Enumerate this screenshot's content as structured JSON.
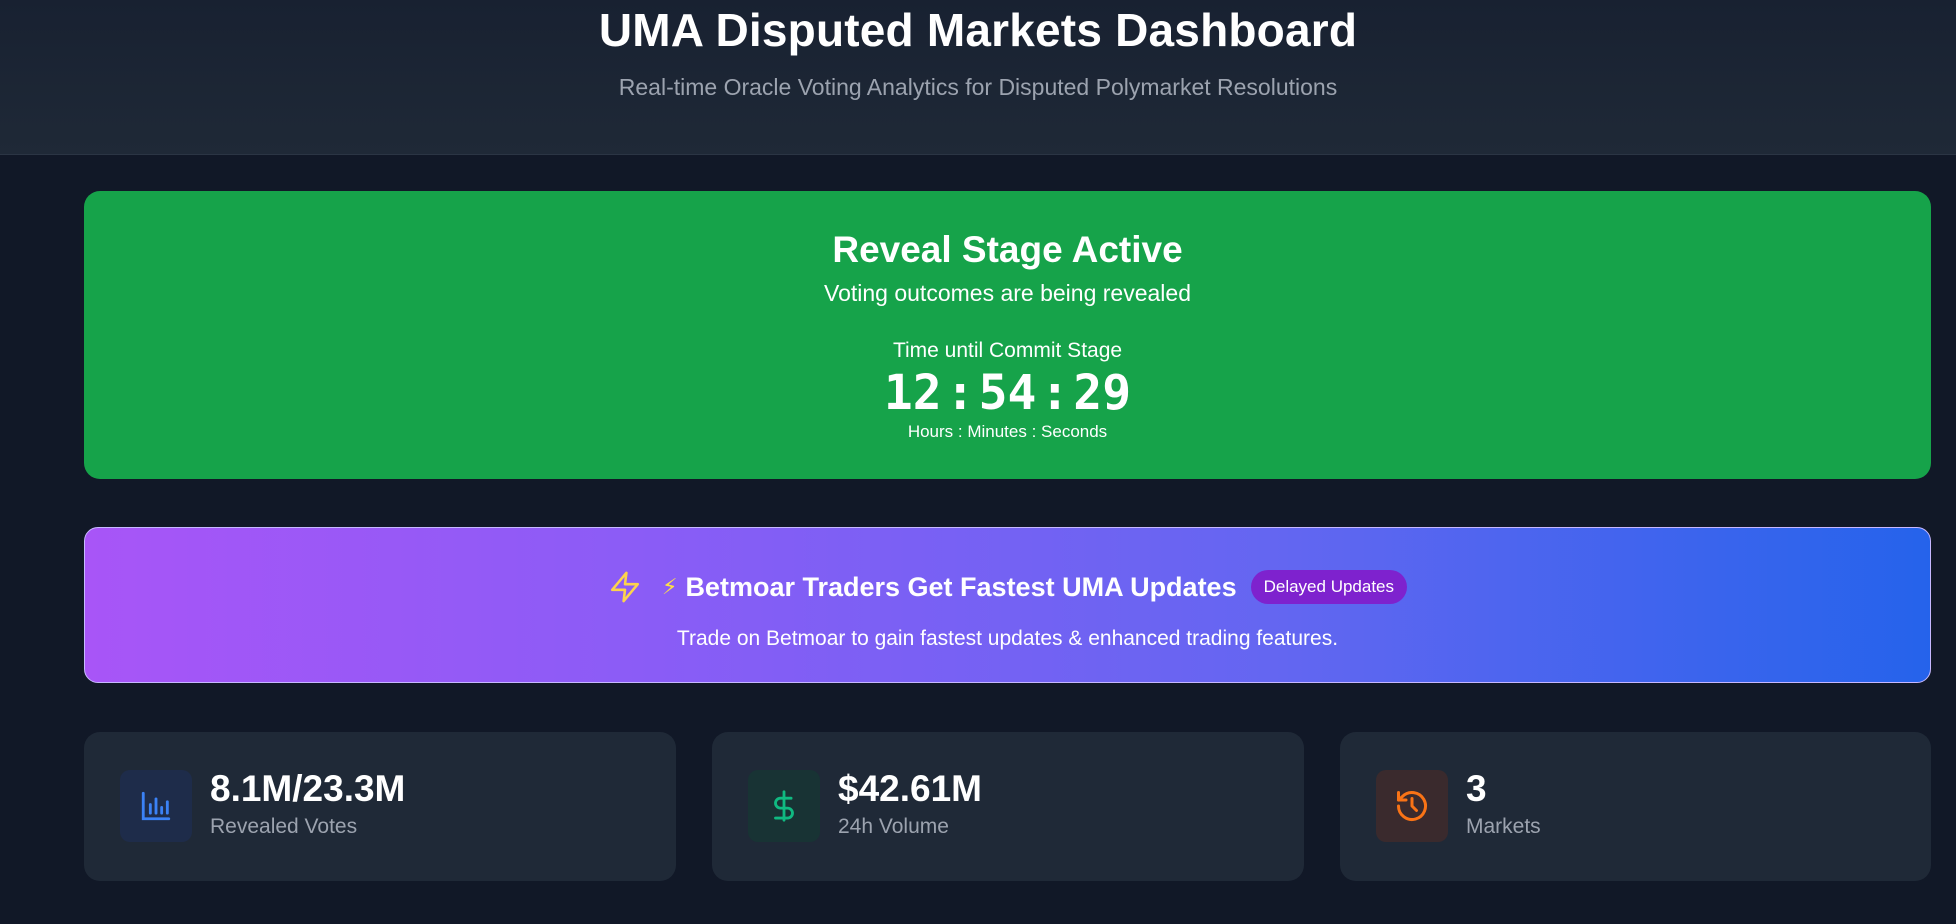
{
  "header": {
    "title": "UMA Disputed Markets Dashboard",
    "subtitle": "Real-time Oracle Voting Analytics for Disputed Polymarket Resolutions"
  },
  "stage_banner": {
    "title": "Reveal Stage Active",
    "description": "Voting outcomes are being revealed",
    "countdown_label": "Time until Commit Stage",
    "countdown": {
      "hours": "12",
      "minutes": "54",
      "seconds": "29",
      "separator": ":"
    },
    "units_label": "Hours : Minutes : Seconds",
    "color": "#16a34a"
  },
  "promo": {
    "icon": "lightning-bolt-icon",
    "emoji": "⚡",
    "title": "Betmoar Traders Get Fastest UMA Updates",
    "badge": "Delayed Updates",
    "text": "Trade on Betmoar to gain fastest updates & enhanced trading features."
  },
  "stats": [
    {
      "icon": "bar-chart-icon",
      "value": "8.1M/23.3M",
      "label": "Revealed Votes",
      "color": "#3b82f6"
    },
    {
      "icon": "dollar-icon",
      "value": "$42.61M",
      "label": "24h Volume",
      "color": "#10b981"
    },
    {
      "icon": "history-icon",
      "value": "3",
      "label": "Markets",
      "color": "#f97316"
    }
  ]
}
